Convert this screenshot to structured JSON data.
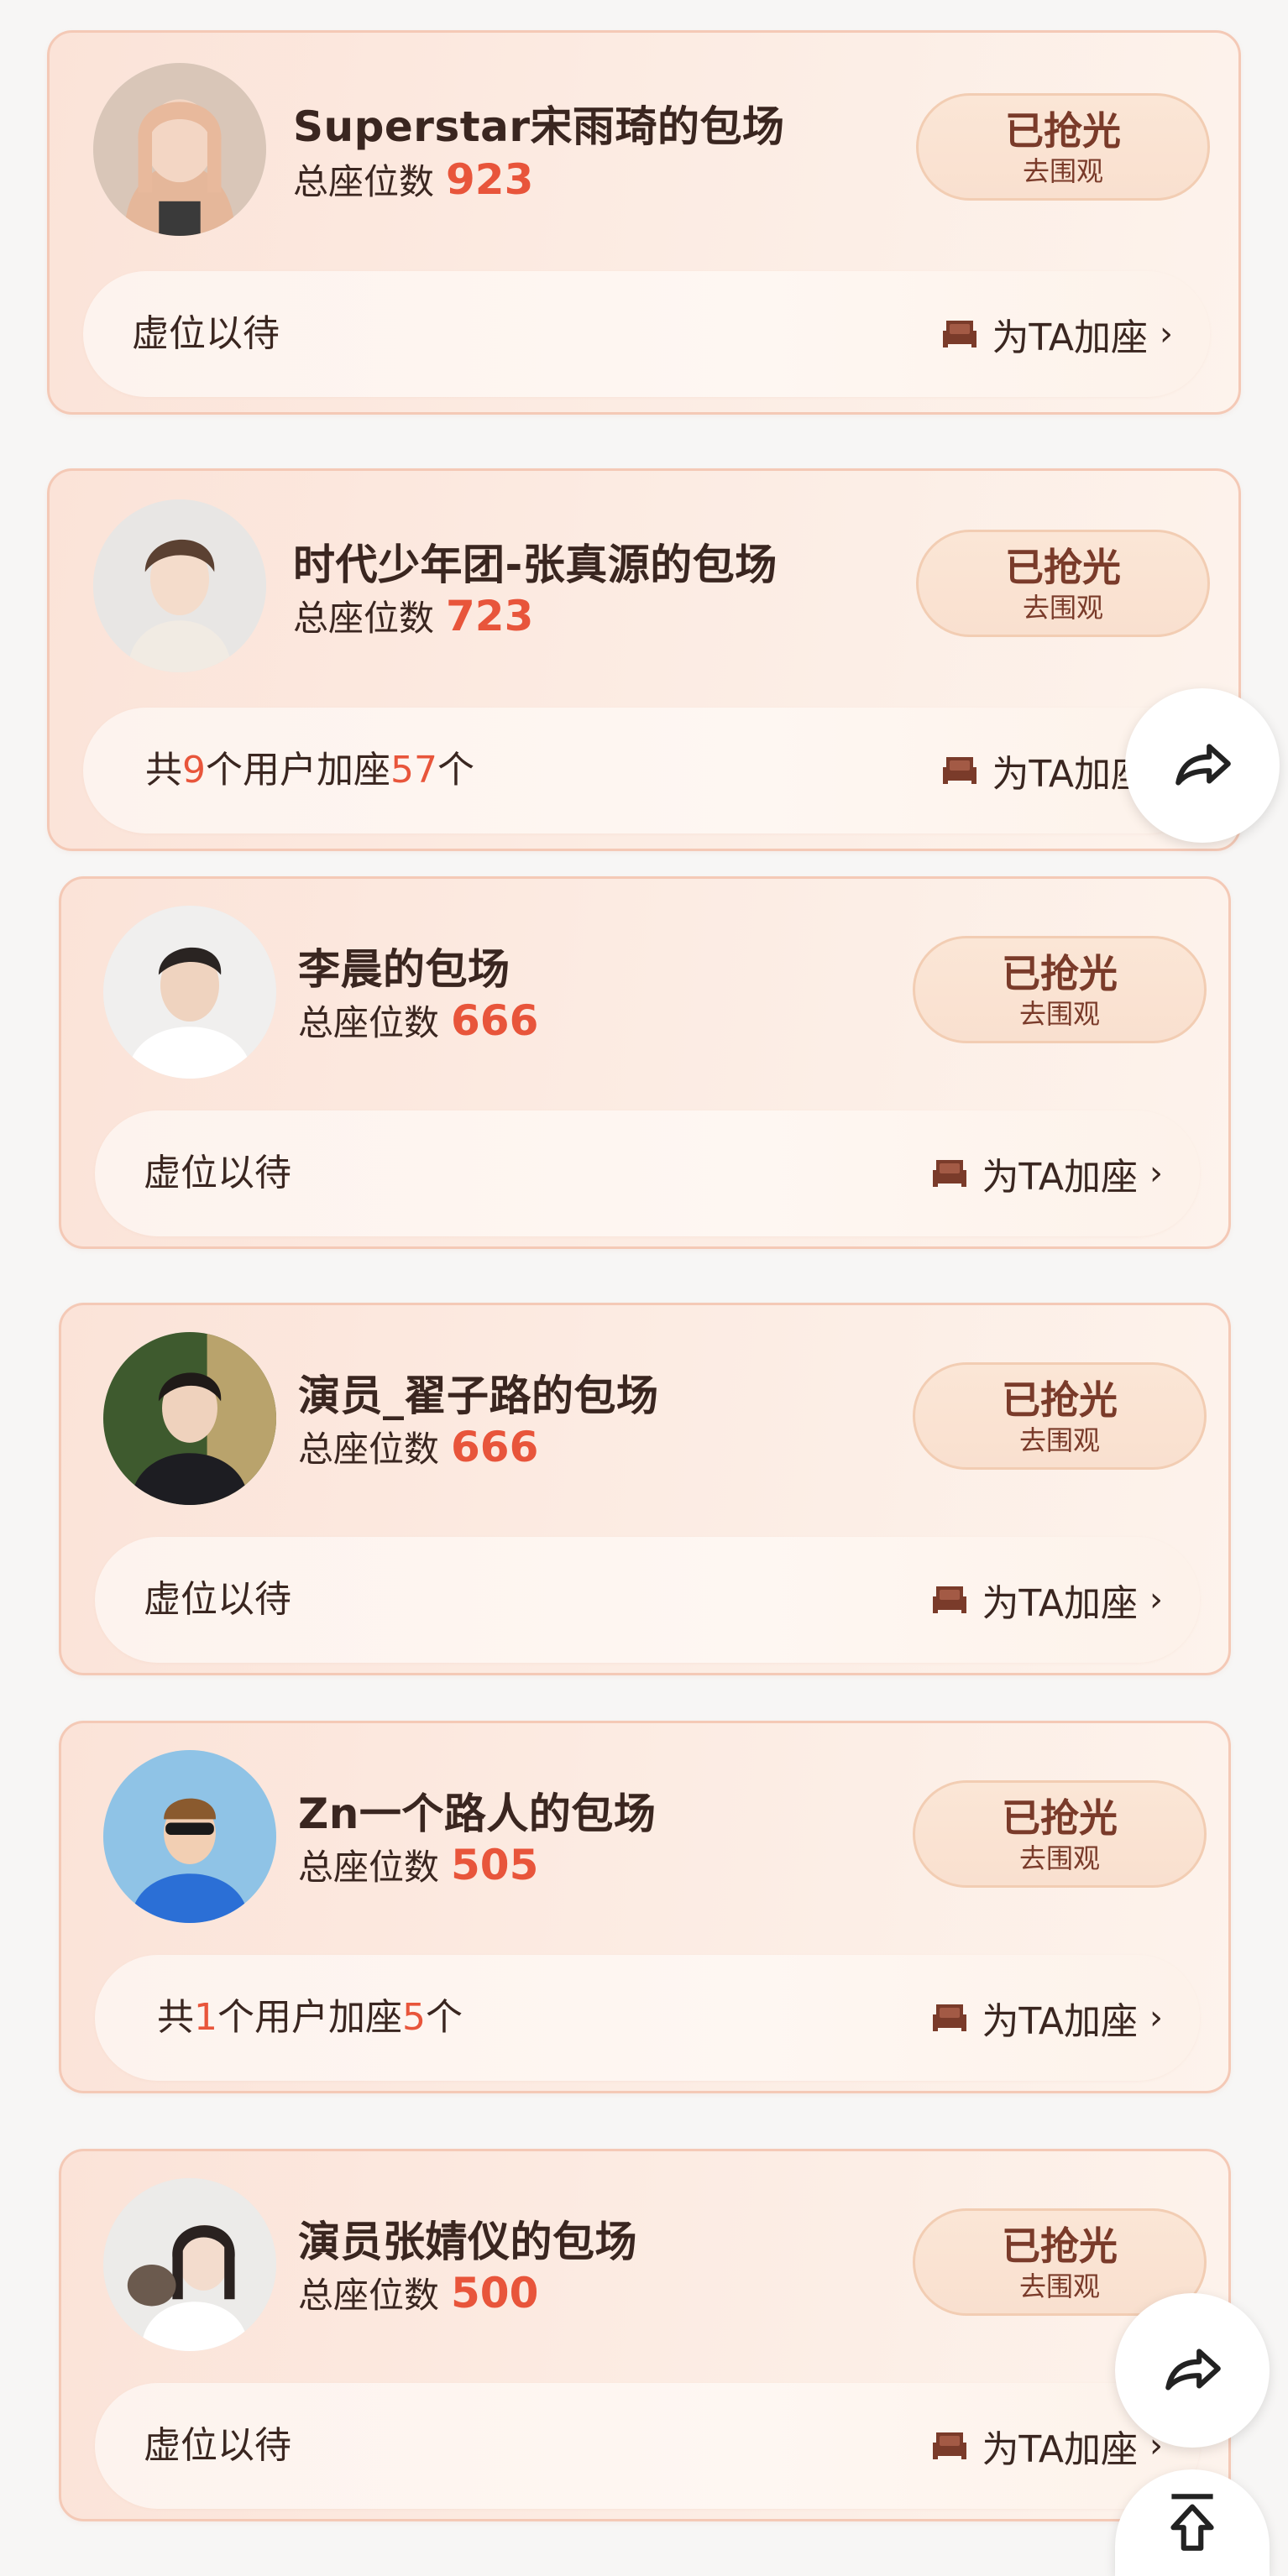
{
  "cards": [
    {
      "title": "Superstar宋雨琦的包场",
      "seat_label": "总座位数",
      "seat_count": "923",
      "status_main": "已抢光",
      "status_sub": "去围观",
      "bar_text": "虚位以待",
      "add_seat_label": "为TA加座",
      "avatar_icon": "avatar-photo"
    },
    {
      "title": "时代少年团-张真源的包场",
      "seat_label": "总座位数",
      "seat_count": "723",
      "status_main": "已抢光",
      "status_sub": "去围观",
      "bar_prefix": "共",
      "bar_users": "9",
      "bar_mid": "个用户加座",
      "bar_seats": "57",
      "bar_suffix": "个",
      "add_seat_label": "为TA加座",
      "avatar_icon": "avatar-photo"
    },
    {
      "title": "李晨的包场",
      "seat_label": "总座位数",
      "seat_count": "666",
      "status_main": "已抢光",
      "status_sub": "去围观",
      "bar_text": "虚位以待",
      "add_seat_label": "为TA加座",
      "avatar_icon": "avatar-photo"
    },
    {
      "title": "演员_翟子路的包场",
      "seat_label": "总座位数",
      "seat_count": "666",
      "status_main": "已抢光",
      "status_sub": "去围观",
      "bar_text": "虚位以待",
      "add_seat_label": "为TA加座",
      "avatar_icon": "avatar-photo"
    },
    {
      "title": "Zn一个路人的包场",
      "seat_label": "总座位数",
      "seat_count": "505",
      "status_main": "已抢光",
      "status_sub": "去围观",
      "bar_prefix": "共",
      "bar_users": "1",
      "bar_mid": "个用户加座",
      "bar_seats": "5",
      "bar_suffix": "个",
      "add_seat_label": "为TA加座",
      "avatar_icon": "avatar-photo"
    },
    {
      "title": "演员张婧仪的包场",
      "seat_label": "总座位数",
      "seat_count": "500",
      "status_main": "已抢光",
      "status_sub": "去围观",
      "bar_text": "虚位以待",
      "add_seat_label": "为TA加座",
      "avatar_icon": "avatar-photo"
    }
  ],
  "floating_buttons": {
    "share_icon": "share-arrow-icon",
    "top_icon": "back-to-top-icon"
  },
  "colors": {
    "accent": "#e8553b",
    "card_border": "#f4c9b6",
    "text": "#3a2620",
    "button_text": "#7a3b2a"
  }
}
